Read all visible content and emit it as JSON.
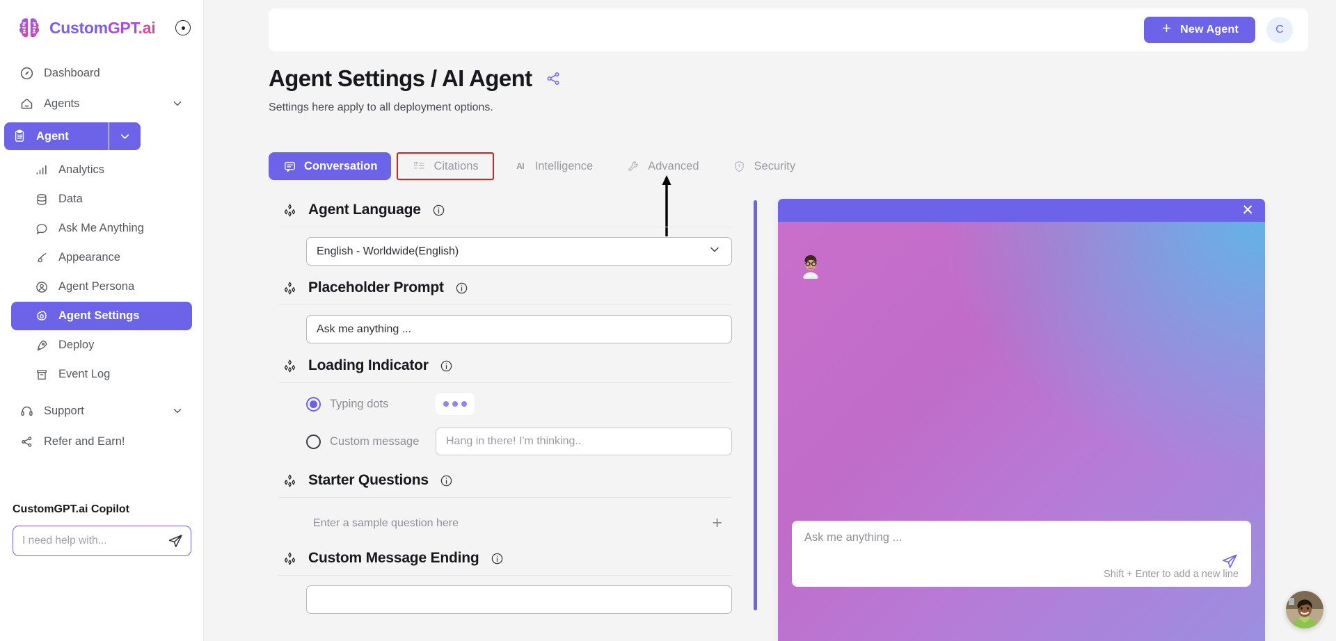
{
  "brand": {
    "name_part1": "Custom",
    "name_part2": "GPT",
    "name_part3": ".ai",
    "logo_icon": "brain-logo-icon",
    "collapse_icon": "collapse-sidebar-icon"
  },
  "sidebar": {
    "nav": [
      {
        "label": "Dashboard",
        "icon": "dashboard-icon",
        "has_chevron": false
      },
      {
        "label": "Agents",
        "icon": "agents-home-icon",
        "has_chevron": true
      }
    ],
    "agent_pill": {
      "label": "Agent",
      "icon": "clipboard-icon",
      "chevron_icon": "chevron-down-icon"
    },
    "sub_items": [
      {
        "label": "Analytics",
        "icon": "bar-chart-icon",
        "active": false
      },
      {
        "label": "Data",
        "icon": "database-icon",
        "active": false
      },
      {
        "label": "Ask Me Anything",
        "icon": "chat-bubble-icon",
        "active": false
      },
      {
        "label": "Appearance",
        "icon": "paintbrush-icon",
        "active": false
      },
      {
        "label": "Agent Persona",
        "icon": "user-circle-icon",
        "active": false
      },
      {
        "label": "Agent Settings",
        "icon": "gear-icon",
        "active": true
      },
      {
        "label": "Deploy",
        "icon": "rocket-icon",
        "active": false
      },
      {
        "label": "Event Log",
        "icon": "archive-icon",
        "active": false
      }
    ],
    "footer_nav": [
      {
        "label": "Support",
        "icon": "headset-icon",
        "has_chevron": true
      },
      {
        "label": "Refer and Earn!",
        "icon": "share-nodes-icon",
        "has_chevron": false
      }
    ],
    "copilot": {
      "title": "CustomGPT.ai Copilot",
      "placeholder": "I need help with...",
      "value": "",
      "send_icon": "send-paperplane-icon"
    }
  },
  "topbar": {
    "new_agent_label": "New Agent",
    "new_agent_plus_icon": "plus-icon",
    "avatar_initial": "C"
  },
  "page": {
    "title": "Agent Settings / AI Agent",
    "share_icon": "share-icon",
    "subtitle": "Settings here apply to all deployment options."
  },
  "tabs": [
    {
      "label": "Conversation",
      "icon": "speech-bubble-icon",
      "state": "active"
    },
    {
      "label": "Citations",
      "icon": "quote-list-icon",
      "state": "highlighted"
    },
    {
      "label": "Intelligence",
      "icon": "ai-text-icon",
      "state": "default"
    },
    {
      "label": "Advanced",
      "icon": "wrench-icon",
      "state": "default"
    },
    {
      "label": "Security",
      "icon": "shield-check-icon",
      "state": "default"
    }
  ],
  "annotation": {
    "highlight_color": "#f41414",
    "arrow_color": "#000000",
    "target_tab": "Citations"
  },
  "settings": {
    "agent_language": {
      "title": "Agent Language",
      "info_icon": "info-icon",
      "spark_icon": "sparkle-diamond-icon",
      "selected": "English - Worldwide(English)",
      "chevron_icon": "chevron-down-icon"
    },
    "placeholder_prompt": {
      "title": "Placeholder Prompt",
      "info_icon": "info-icon",
      "spark_icon": "sparkle-diamond-icon",
      "value": "Ask me anything ...",
      "placeholder": "Ask me anything ..."
    },
    "loading_indicator": {
      "title": "Loading Indicator",
      "info_icon": "info-icon",
      "spark_icon": "sparkle-diamond-icon",
      "typing_dots_label": "Typing dots",
      "typing_dots_selected": true,
      "custom_message_label": "Custom message",
      "custom_message_selected": false,
      "custom_message_value": "Hang in there! I'm thinking..",
      "custom_message_placeholder": "Hang in there! I'm thinking.."
    },
    "starter_questions": {
      "title": "Starter Questions",
      "info_icon": "info-icon",
      "spark_icon": "sparkle-diamond-icon",
      "placeholder": "Enter a sample question here",
      "value": "",
      "add_icon": "plus-icon"
    },
    "custom_message_ending": {
      "title": "Custom Message Ending",
      "info_icon": "info-icon",
      "spark_icon": "sparkle-diamond-icon",
      "value": "",
      "placeholder": ""
    }
  },
  "chat_preview": {
    "close_icon": "close-icon",
    "avatar_icon": "agent-avatar-image",
    "input_placeholder": "Ask me anything ...",
    "hint": "Shift + Enter to add a new line",
    "send_icon": "send-paperplane-icon",
    "header_color": "#6c63e8"
  },
  "fab": {
    "icon": "support-agent-avatar-image"
  },
  "colors": {
    "accent_purple": "#6c63e8",
    "annotation_red": "#f41414",
    "page_bg": "#f4f4f5",
    "sidebar_bg": "#ffffff",
    "gradient_pink": "#d263b8",
    "gradient_blue": "#63b3e8"
  }
}
